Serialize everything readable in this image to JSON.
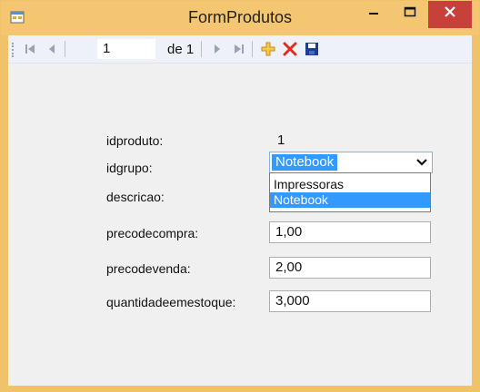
{
  "window": {
    "title": "FormProdutos",
    "accent_color": "#f5c672",
    "close_color": "#c7413a"
  },
  "toolbar": {
    "icons": [
      "first-record-icon",
      "previous-record-icon",
      "next-record-icon",
      "last-record-icon",
      "add-icon",
      "delete-icon",
      "save-icon"
    ],
    "position": "1",
    "of_label": "de 1"
  },
  "form": {
    "idproduto": {
      "label": "idproduto:",
      "value": "1"
    },
    "idgrupo": {
      "label": "idgrupo:",
      "value": "Notebook"
    },
    "descricao": {
      "label": "descricao:"
    },
    "precodecompra": {
      "label": "precodecompra:",
      "value": "1,00"
    },
    "precodevenda": {
      "label": "precodevenda:",
      "value": "2,00"
    },
    "quantidadeemestoque": {
      "label": "quantidadeemestoque:",
      "value": "3,000"
    }
  },
  "dropdown": {
    "options": [
      "Impressoras",
      "Notebook"
    ],
    "selected": "Notebook",
    "highlight_color": "#3399ff"
  }
}
